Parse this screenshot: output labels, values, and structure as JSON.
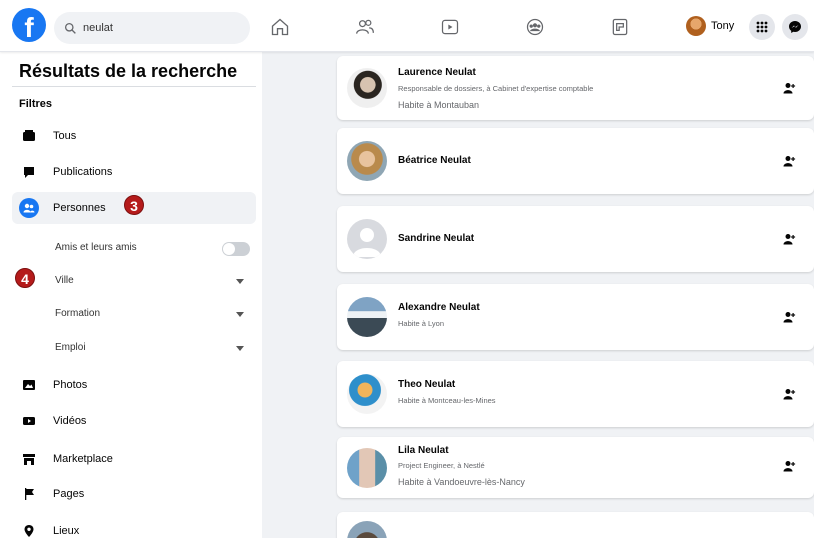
{
  "search": {
    "value": "neulat"
  },
  "header": {
    "user_name": "Tony"
  },
  "sidebar": {
    "title": "Résultats de la recherche",
    "filters_label": "Filtres",
    "items": [
      {
        "label": "Tous",
        "icon": "posts-icon"
      },
      {
        "label": "Publications",
        "icon": "chat-icon"
      },
      {
        "label": "Personnes",
        "icon": "people-icon"
      },
      {
        "label": "Photos",
        "icon": "photo-icon"
      },
      {
        "label": "Vidéos",
        "icon": "video-icon"
      },
      {
        "label": "Marketplace",
        "icon": "shop-icon"
      },
      {
        "label": "Pages",
        "icon": "flag-icon"
      },
      {
        "label": "Lieux",
        "icon": "pin-icon"
      }
    ],
    "sub_filters": {
      "friends_label": "Amis et leurs amis",
      "city_label": "Ville",
      "education_label": "Formation",
      "job_label": "Emploi"
    },
    "badges": [
      "3",
      "4"
    ]
  },
  "results": [
    {
      "name": "Laurence Neulat",
      "line1": "Responsable de dossiers, à Cabinet d'expertise comptable",
      "line2": "Habite à Montauban"
    },
    {
      "name": "Béatrice Neulat"
    },
    {
      "name": "Sandrine Neulat"
    },
    {
      "name": "Alexandre Neulat",
      "line1": "Habite à Lyon"
    },
    {
      "name": "Theo Neulat",
      "line1": "Habite à Montceau-les-Mines"
    },
    {
      "name": "Lila Neulat",
      "line1": "Project Engineer, à Nestlé",
      "line2": "Habite à Vandoeuvre-lès-Nancy"
    }
  ],
  "colors": {
    "brand": "#1877f2",
    "badge": "#b51b1b",
    "background": "#f0f2f5"
  }
}
